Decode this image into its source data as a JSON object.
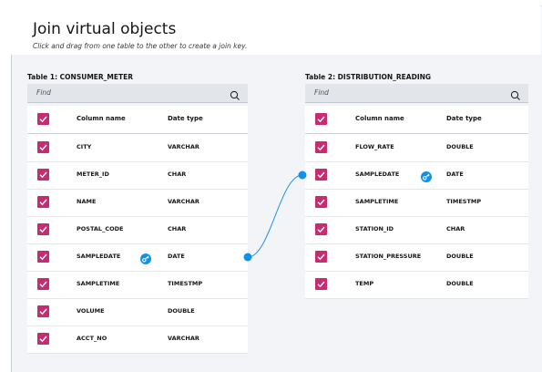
{
  "title": "Join virtual objects",
  "subtitle": "Click and drag from one  table to the other to create a join key.",
  "tables": [
    {
      "label": "Table 1: CONSUMER_METER",
      "find_placeholder": "Find",
      "headers": {
        "name": "Column name",
        "type": "Date type"
      },
      "rows": [
        {
          "name": "CITY",
          "type": "VARCHAR"
        },
        {
          "name": "METER_ID",
          "type": "CHAR"
        },
        {
          "name": "NAME",
          "type": "VARCHAR"
        },
        {
          "name": "POSTAL_CODE",
          "type": "CHAR"
        },
        {
          "name": "SAMPLEDATE",
          "type": "DATE",
          "key": true
        },
        {
          "name": "SAMPLETIME",
          "type": "TIMESTMP"
        },
        {
          "name": "VOLUME",
          "type": "DOUBLE"
        },
        {
          "name": "ACCT_NO",
          "type": "VARCHAR"
        }
      ]
    },
    {
      "label": "Table 2: DISTRIBUTION_READING",
      "find_placeholder": "Find",
      "headers": {
        "name": "Column name",
        "type": "Date type"
      },
      "rows": [
        {
          "name": "FLOW_RATE",
          "type": "DOUBLE"
        },
        {
          "name": "SAMPLEDATE",
          "type": "DATE",
          "key": true
        },
        {
          "name": "SAMPLETIME",
          "type": "TIMESTMP"
        },
        {
          "name": "STATION_ID",
          "type": "CHAR"
        },
        {
          "name": "STATION_PRESSURE",
          "type": "DOUBLE"
        },
        {
          "name": "TEMP",
          "type": "DOUBLE"
        }
      ]
    }
  ],
  "colors": {
    "checkbox": "#c72c70",
    "link": "#1192e8",
    "key_icon": "#1192e8"
  },
  "join": {
    "from_table": 0,
    "from_row": 4,
    "to_table": 1,
    "to_row": 1
  }
}
